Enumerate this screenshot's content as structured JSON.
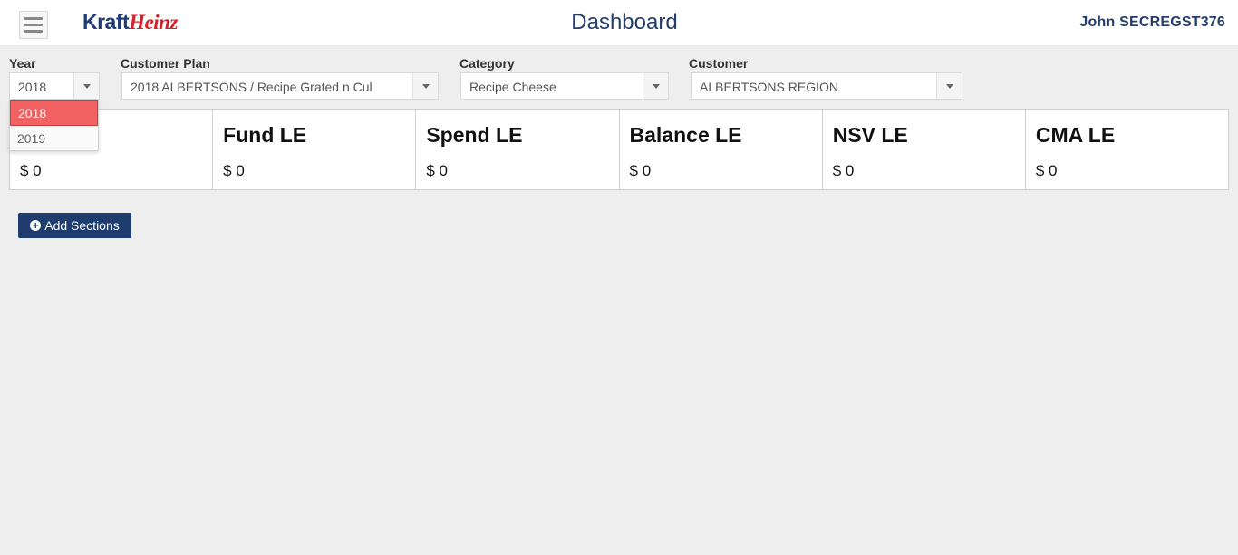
{
  "header": {
    "logo_kraft": "Kraft",
    "logo_heinz": "Heinz",
    "title": "Dashboard",
    "user": "John SECREGST376",
    "menu_icon": "hamburger-menu-icon"
  },
  "filters": {
    "year": {
      "label": "Year",
      "value": "2018",
      "options": [
        "2018",
        "2019"
      ]
    },
    "customer_plan": {
      "label": "Customer Plan",
      "value": "2018 ALBERTSONS / Recipe Grated n Cul"
    },
    "category": {
      "label": "Category",
      "value": "Recipe Cheese"
    },
    "customer": {
      "label": "Customer",
      "value": "ALBERTSONS REGION"
    }
  },
  "kpis": [
    {
      "title": "",
      "value": "$ 0"
    },
    {
      "title": "Fund LE",
      "value": "$ 0"
    },
    {
      "title": "Spend LE",
      "value": "$ 0"
    },
    {
      "title": "Balance LE",
      "value": "$ 0"
    },
    {
      "title": "NSV LE",
      "value": "$ 0"
    },
    {
      "title": "CMA LE",
      "value": "$ 0"
    }
  ],
  "actions": {
    "add_sections": "Add Sections",
    "add_icon": "plus-circle-icon"
  },
  "colors": {
    "brand_navy": "#1f3c6e",
    "brand_red": "#d6202a",
    "selected_option": "#f26262"
  }
}
